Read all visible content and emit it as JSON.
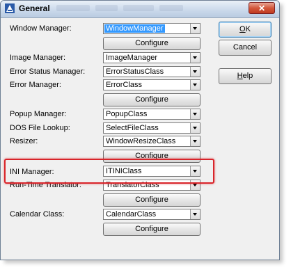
{
  "window": {
    "title": "General",
    "close_label": "✕",
    "accent": "#3399ff",
    "highlight_color": "#d9242a"
  },
  "fields": [
    {
      "label": "Window Manager:",
      "value": "WindowManager"
    },
    {
      "label": "Image Manager:",
      "value": "ImageManager"
    },
    {
      "label": "Error Status Manager:",
      "value": "ErrorStatusClass"
    },
    {
      "label": "Error Manager:",
      "value": "ErrorClass"
    },
    {
      "label": "Popup Manager:",
      "value": "PopupClass"
    },
    {
      "label": "DOS File Lookup:",
      "value": "SelectFileClass"
    },
    {
      "label": "Resizer:",
      "value": "WindowResizeClass"
    },
    {
      "label": "INI Manager:",
      "value": "ITINIClass"
    },
    {
      "label": "Run-Time Translator:",
      "value": "TranslatorClass"
    },
    {
      "label": "Calendar Class:",
      "value": "CalendarClass"
    }
  ],
  "configure_label": "Configure",
  "buttons": {
    "ok_u": "O",
    "ok_rest": "K",
    "cancel": "Cancel",
    "help_u": "H",
    "help_rest": "elp"
  },
  "icons": {
    "app": "app-icon",
    "dropdown": "chevron-down-icon"
  }
}
